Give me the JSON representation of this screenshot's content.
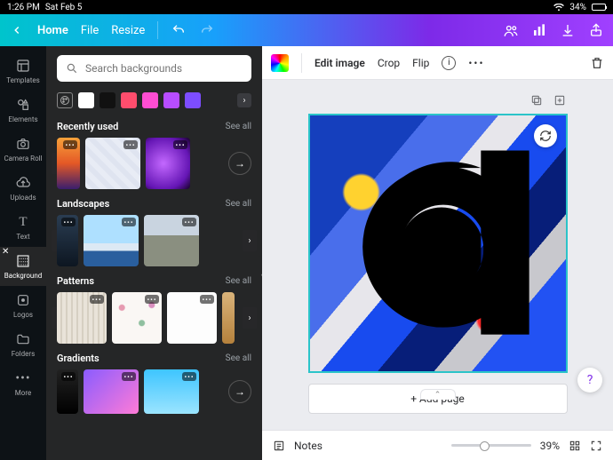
{
  "status": {
    "time": "1:26 PM",
    "date": "Sat Feb 5",
    "battery_pct": "34%"
  },
  "topbar": {
    "home": "Home",
    "file": "File",
    "resize": "Resize"
  },
  "rail": {
    "templates": "Templates",
    "elements": "Elements",
    "camera_roll": "Camera Roll",
    "uploads": "Uploads",
    "text": "Text",
    "background": "Background",
    "logos": "Logos",
    "folders": "Folders",
    "more": "More"
  },
  "panel": {
    "search_placeholder": "Search backgrounds",
    "colors": [
      "#ffffff",
      "#111111",
      "#ff4d6d",
      "#ff4dd2",
      "#b84dff",
      "#7d4dff"
    ],
    "sections": {
      "recent": {
        "title": "Recently used",
        "see_all": "See all"
      },
      "landscapes": {
        "title": "Landscapes",
        "see_all": "See all"
      },
      "patterns": {
        "title": "Patterns",
        "see_all": "See all"
      },
      "gradients": {
        "title": "Gradients",
        "see_all": "See all"
      }
    }
  },
  "context": {
    "edit_image": "Edit image",
    "crop": "Crop",
    "flip": "Flip"
  },
  "canvas": {
    "add_page": "+ Add page"
  },
  "bottom": {
    "notes": "Notes",
    "zoom": "39%"
  }
}
